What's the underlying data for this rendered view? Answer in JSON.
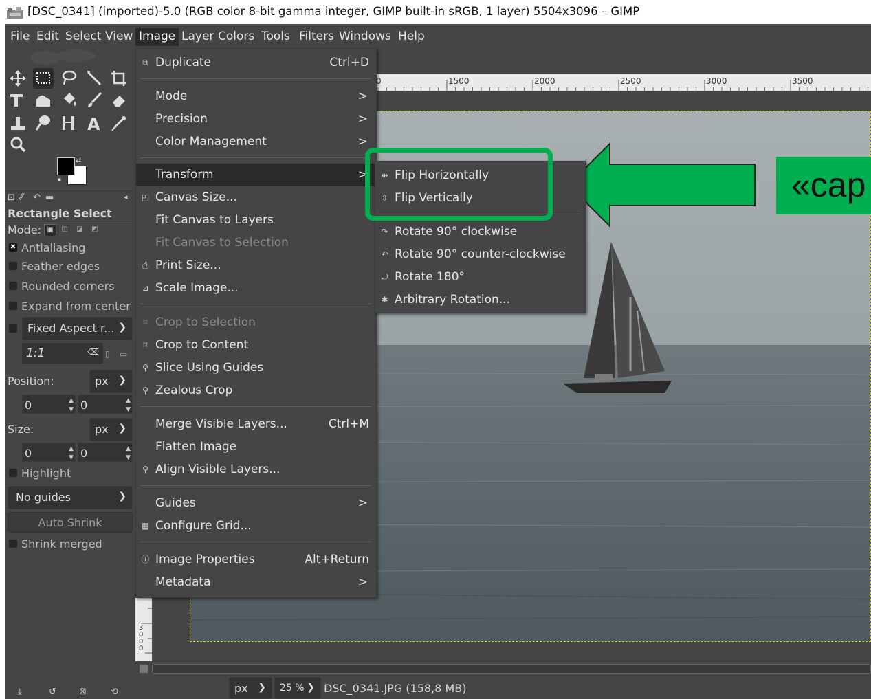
{
  "window": {
    "title": "[DSC_0341] (imported)-5.0 (RGB color 8-bit gamma integer, GIMP built-in sRGB, 1 layer) 5504x3096 – GIMP"
  },
  "menubar": [
    "File",
    "Edit",
    "Select",
    "View",
    "Image",
    "Layer",
    "Colors",
    "Tools",
    "Filters",
    "Windows",
    "Help"
  ],
  "image_menu": {
    "duplicate": "Duplicate",
    "duplicate_sc": "Ctrl+D",
    "mode": "Mode",
    "precision": "Precision",
    "color_management": "Color Management",
    "transform": "Transform",
    "canvas_size": "Canvas Size...",
    "fit_canvas_layers": "Fit Canvas to Layers",
    "fit_canvas_selection": "Fit Canvas to Selection",
    "print_size": "Print Size...",
    "scale_image": "Scale Image...",
    "crop_selection": "Crop to Selection",
    "crop_content": "Crop to Content",
    "slice_guides": "Slice Using Guides",
    "zealous_crop": "Zealous Crop",
    "merge_visible": "Merge Visible Layers...",
    "merge_visible_sc": "Ctrl+M",
    "flatten": "Flatten Image",
    "align_visible": "Align Visible Layers...",
    "guides": "Guides",
    "configure_grid": "Configure Grid...",
    "image_properties": "Image Properties",
    "image_properties_sc": "Alt+Return",
    "metadata": "Metadata",
    "submenu_arrow": ">"
  },
  "transform_menu": {
    "flip_h": "Flip Horizontally",
    "flip_v": "Flip Vertically",
    "rot90cw": "Rotate 90° clockwise",
    "rot90ccw": "Rotate 90° counter-clockwise",
    "rot180": "Rotate 180°",
    "arbitrary": "Arbitrary Rotation..."
  },
  "callout": {
    "text": "«cap",
    "color": "#00b050"
  },
  "tool_options": {
    "title": "Rectangle Select",
    "mode_label": "Mode:",
    "antialiasing": "Antialiasing",
    "feather": "Feather edges",
    "rounded": "Rounded corners",
    "expand": "Expand from center",
    "fixed": "Fixed Aspect r...",
    "ratio": "1:1",
    "position_label": "Position:",
    "pos_unit": "px",
    "pos_x": "0",
    "pos_y": "0",
    "size_label": "Size:",
    "size_unit": "px",
    "size_x": "0",
    "size_y": "0",
    "highlight": "Highlight",
    "guides": "No guides",
    "auto_shrink": "Auto Shrink",
    "shrink_merged": "Shrink merged"
  },
  "ruler": {
    "h_ticks": [
      "0",
      "1500",
      "2000",
      "2500",
      "3000",
      "3500"
    ],
    "v_label": "3000"
  },
  "status": {
    "unit": "px",
    "zoom": "25 %",
    "file": "DSC_0341.JPG (158,8 MB)"
  }
}
